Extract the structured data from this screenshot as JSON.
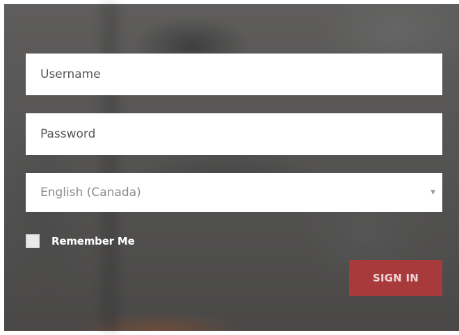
{
  "login_form": {
    "username": {
      "placeholder": "Username",
      "value": ""
    },
    "password": {
      "placeholder": "Password",
      "value": ""
    },
    "language": {
      "selected": "English (Canada)",
      "arrow_icon": "caret-down-icon"
    },
    "remember_me": {
      "label": "Remember Me",
      "checked": false
    },
    "sign_in_label": "SIGN IN"
  },
  "colors": {
    "sign_in_button": "#a93a3c",
    "backdrop": "#565554",
    "field_background": "#ffffff"
  }
}
